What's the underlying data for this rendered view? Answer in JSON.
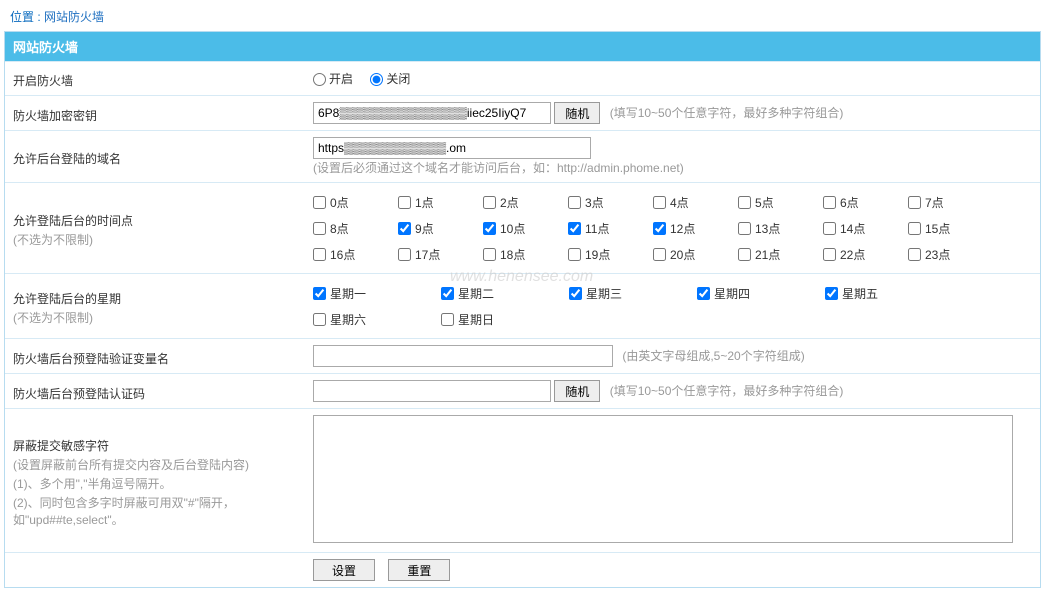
{
  "breadcrumb": {
    "label": "位置 :",
    "link": "网站防火墙"
  },
  "header": {
    "title": "网站防火墙"
  },
  "rows": {
    "enable": {
      "label": "开启防火墙",
      "opt_on": "开启",
      "opt_off": "关闭",
      "selected": "off"
    },
    "key": {
      "label": "防火墙加密密钥",
      "value": "6P8▒▒▒▒▒▒▒▒▒▒▒▒▒▒▒iiec25IiyQ7",
      "random_btn": "随机",
      "hint": "(填写10~50个任意字符，最好多种字符组合)"
    },
    "domain": {
      "label": "允许后台登陆的域名",
      "value": "https▒▒▒▒▒▒▒▒▒▒▒▒.om",
      "note": "(设置后必须通过这个域名才能访问后台，如：http://admin.phome.net)"
    },
    "hours": {
      "label": "允许登陆后台的时间点",
      "sub": "(不选为不限制)",
      "items": [
        {
          "label": "0点",
          "checked": false
        },
        {
          "label": "1点",
          "checked": false
        },
        {
          "label": "2点",
          "checked": false
        },
        {
          "label": "3点",
          "checked": false
        },
        {
          "label": "4点",
          "checked": false
        },
        {
          "label": "5点",
          "checked": false
        },
        {
          "label": "6点",
          "checked": false
        },
        {
          "label": "7点",
          "checked": false
        },
        {
          "label": "8点",
          "checked": false
        },
        {
          "label": "9点",
          "checked": true
        },
        {
          "label": "10点",
          "checked": true
        },
        {
          "label": "11点",
          "checked": true
        },
        {
          "label": "12点",
          "checked": true
        },
        {
          "label": "13点",
          "checked": false
        },
        {
          "label": "14点",
          "checked": false
        },
        {
          "label": "15点",
          "checked": false
        },
        {
          "label": "16点",
          "checked": false
        },
        {
          "label": "17点",
          "checked": false
        },
        {
          "label": "18点",
          "checked": false
        },
        {
          "label": "19点",
          "checked": false
        },
        {
          "label": "20点",
          "checked": false
        },
        {
          "label": "21点",
          "checked": false
        },
        {
          "label": "22点",
          "checked": false
        },
        {
          "label": "23点",
          "checked": false
        }
      ]
    },
    "weeks": {
      "label": "允许登陆后台的星期",
      "sub": "(不选为不限制)",
      "items": [
        {
          "label": "星期一",
          "checked": true
        },
        {
          "label": "星期二",
          "checked": true
        },
        {
          "label": "星期三",
          "checked": true
        },
        {
          "label": "星期四",
          "checked": true
        },
        {
          "label": "星期五",
          "checked": true
        },
        {
          "label": "星期六",
          "checked": false
        },
        {
          "label": "星期日",
          "checked": false
        }
      ]
    },
    "varname": {
      "label": "防火墙后台预登陆验证变量名",
      "value": "",
      "hint": "(由英文字母组成,5~20个字符组成)"
    },
    "passcode": {
      "label": "防火墙后台预登陆认证码",
      "value": "",
      "random_btn": "随机",
      "hint": "(填写10~50个任意字符，最好多种字符组合)"
    },
    "filter": {
      "label": "屏蔽提交敏感字符",
      "notes": [
        "(设置屏蔽前台所有提交内容及后台登陆内容)",
        "(1)、多个用\",\"半角逗号隔开。",
        "(2)、同时包含多字时屏蔽可用双\"#\"隔开，如\"upd##te,select\"。"
      ],
      "value": ""
    },
    "actions": {
      "submit": "设置",
      "reset": "重置"
    }
  },
  "watermark": "www.henensee.com"
}
